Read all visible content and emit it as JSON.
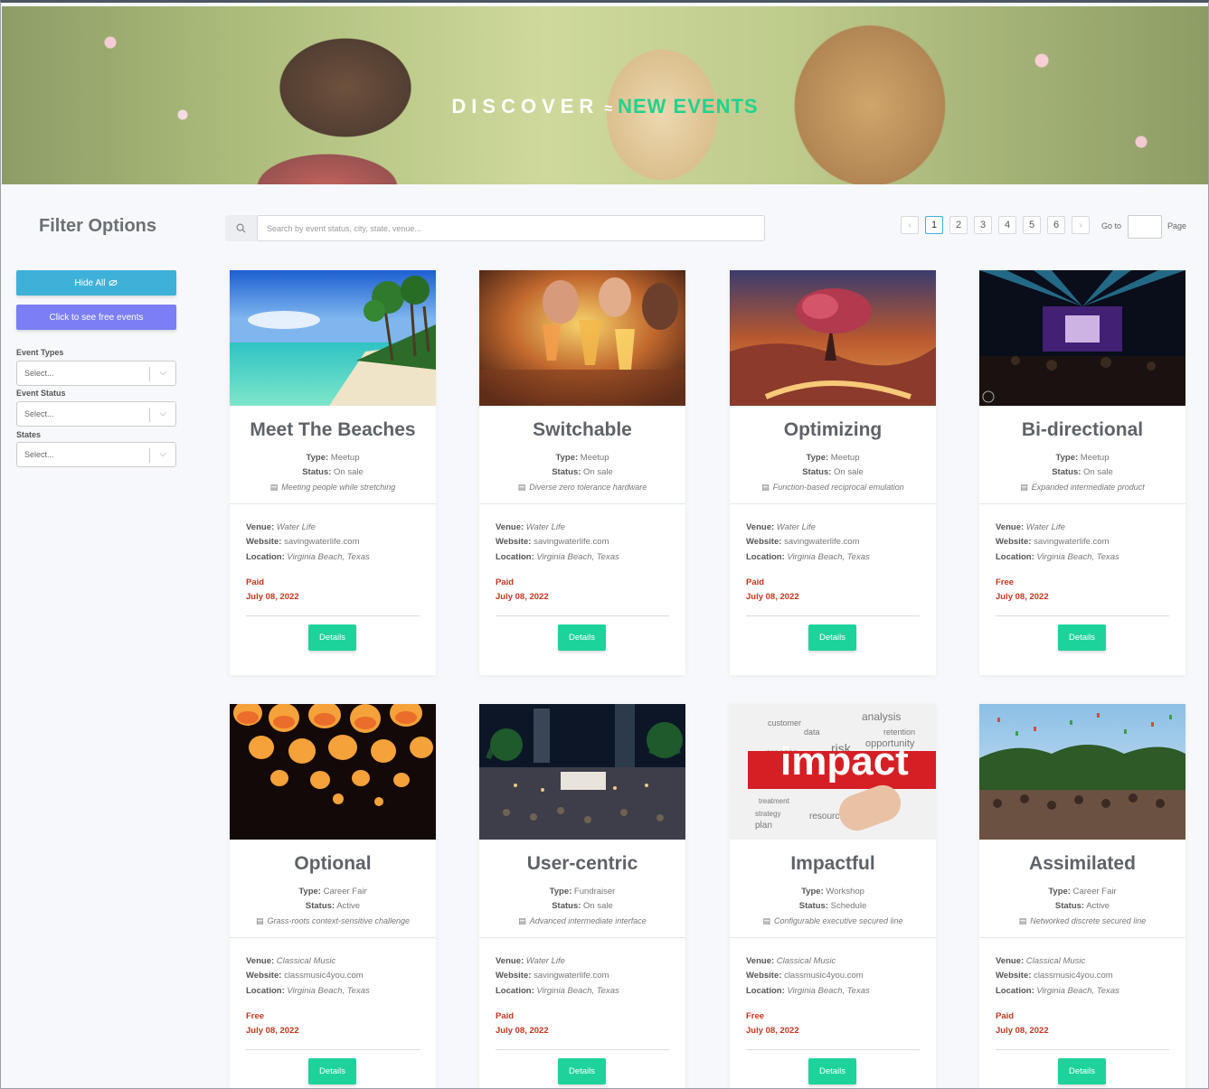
{
  "hero": {
    "title_word1": "DISCOVER",
    "title_word2": "NEW EVENTS"
  },
  "sidebar": {
    "title": "Filter Options",
    "hide_all_label": "Hide All",
    "free_events_label": "Click to see free events",
    "filters": [
      {
        "label": "Event Types",
        "placeholder": "Select..."
      },
      {
        "label": "Event Status",
        "placeholder": "Select..."
      },
      {
        "label": "States",
        "placeholder": "Select..."
      }
    ]
  },
  "search": {
    "placeholder": "Search by event status, city, state, venue..."
  },
  "pagination": {
    "prev": "‹",
    "next": "›",
    "pages": [
      "1",
      "2",
      "3",
      "4",
      "5",
      "6"
    ],
    "current": "1",
    "goto_label": "Go to",
    "page_label": "Page"
  },
  "labels": {
    "type": "Type:",
    "status": "Status:",
    "venue": "Venue:",
    "website": "Website:",
    "location": "Location:",
    "details": "Details"
  },
  "events": [
    {
      "title": "Meet The Beaches",
      "type": "Meetup",
      "status": "On sale",
      "description": "Meeting people while stretching",
      "venue": "Water Life",
      "website": "savingwaterlife.com",
      "location": "Virginia Beach, Texas",
      "price": "Paid",
      "date": "July 08, 2022",
      "image": "beach"
    },
    {
      "title": "Switchable",
      "type": "Meetup",
      "status": "On sale",
      "description": "Diverse zero tolerance hardware",
      "venue": "Water Life",
      "website": "savingwaterlife.com",
      "location": "Virginia Beach, Texas",
      "price": "Paid",
      "date": "July 08, 2022",
      "image": "cheers"
    },
    {
      "title": "Optimizing",
      "type": "Meetup",
      "status": "On sale",
      "description": "Function-based reciprocal emulation",
      "venue": "Water Life",
      "website": "savingwaterlife.com",
      "location": "Virginia Beach, Texas",
      "price": "Paid",
      "date": "July 08, 2022",
      "image": "tree-painting"
    },
    {
      "title": "Bi-directional",
      "type": "Meetup",
      "status": "On sale",
      "description": "Expanded intermediate product",
      "venue": "Water Life",
      "website": "savingwaterlife.com",
      "location": "Virginia Beach, Texas",
      "price": "Free",
      "date": "July 08, 2022",
      "image": "concert"
    },
    {
      "title": "Optional",
      "type": "Career Fair",
      "status": "Active",
      "description": "Grass-roots context-sensitive challenge",
      "venue": "Classical Music",
      "website": "classmusic4you.com",
      "location": "Virginia Beach, Texas",
      "price": "Free",
      "date": "July 08, 2022",
      "image": "lanterns"
    },
    {
      "title": "User-centric",
      "type": "Fundraiser",
      "status": "On sale",
      "description": "Advanced intermediate interface",
      "venue": "Water Life",
      "website": "savingwaterlife.com",
      "location": "Virginia Beach, Texas",
      "price": "Paid",
      "date": "July 08, 2022",
      "image": "night-festival"
    },
    {
      "title": "Impactful",
      "type": "Workshop",
      "status": "Schedule",
      "description": "Configurable executive secured line",
      "venue": "Classical Music",
      "website": "classmusic4you.com",
      "location": "Virginia Beach, Texas",
      "price": "Free",
      "date": "July 08, 2022",
      "image": "impact-wordcloud",
      "image_text": "impact",
      "image_words": [
        "customer",
        "process",
        "risk",
        "analysis",
        "opportunity",
        "retention",
        "treatment",
        "strategy",
        "plan",
        "resources",
        "data"
      ]
    },
    {
      "title": "Assimilated",
      "type": "Career Fair",
      "status": "Active",
      "description": "Networked discrete secured line",
      "venue": "Classical Music",
      "website": "classmusic4you.com",
      "location": "Virginia Beach, Texas",
      "price": "Paid",
      "date": "July 08, 2022",
      "image": "confetti-crowd"
    }
  ],
  "colors": {
    "accent_teal": "#1dd39b",
    "hide_button": "#3fb1d8",
    "free_button": "#7b7ef4",
    "price_red": "#c8341f",
    "hero_green": "#1fd38f"
  }
}
